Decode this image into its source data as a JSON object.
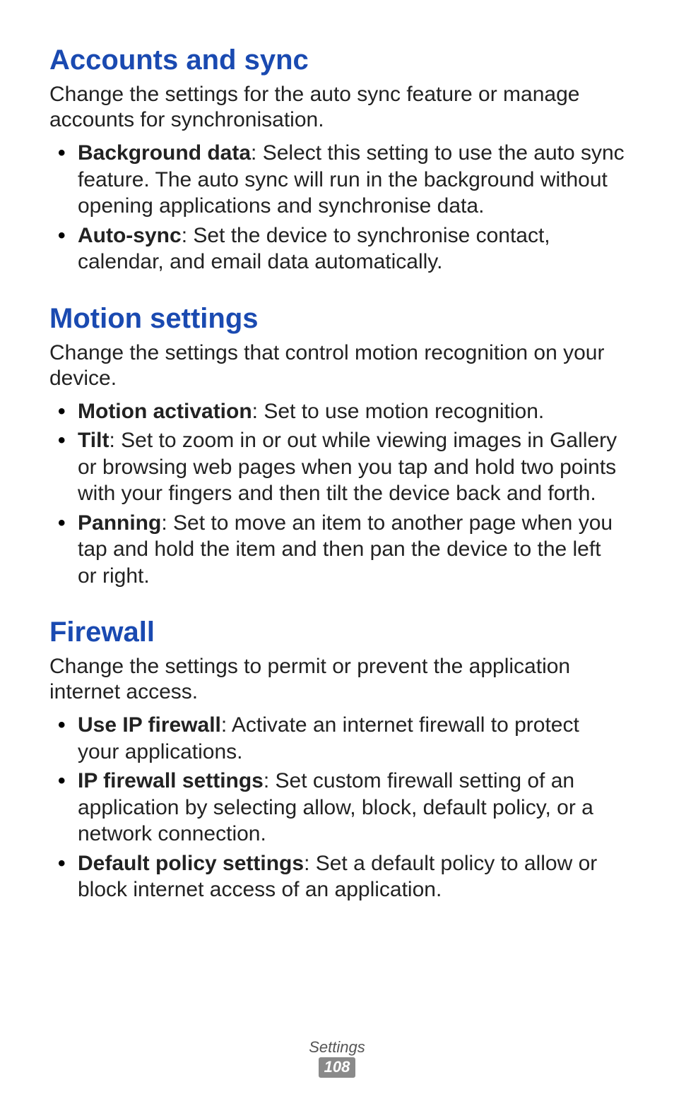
{
  "sections": [
    {
      "title": "Accounts and sync",
      "intro": "Change the settings for the auto sync feature or manage accounts for synchronisation.",
      "items": [
        {
          "term": "Background data",
          "desc": ": Select this setting to use the auto sync feature. The auto sync will run in the background without opening applications and synchronise data."
        },
        {
          "term": "Auto-sync",
          "desc": ": Set the device to synchronise contact, calendar, and email data automatically."
        }
      ]
    },
    {
      "title": "Motion settings",
      "intro": "Change the settings that control motion recognition on your device.",
      "items": [
        {
          "term": "Motion activation",
          "desc": ": Set to use motion recognition."
        },
        {
          "term": "Tilt",
          "desc": ": Set to zoom in or out while viewing images in Gallery or browsing web pages when you tap and hold two points with your fingers and then tilt the device back and forth."
        },
        {
          "term": "Panning",
          "desc": ": Set to move an item to another page when you tap and hold the item and then pan the device to the left or right."
        }
      ]
    },
    {
      "title": "Firewall",
      "intro": "Change the settings to permit or prevent the application internet access.",
      "items": [
        {
          "term": "Use IP firewall",
          "desc": ": Activate an internet firewall to protect your applications."
        },
        {
          "term": "IP firewall settings",
          "desc": ": Set custom firewall setting of an application by selecting allow, block, default policy, or a network connection."
        },
        {
          "term": "Default policy settings",
          "desc": ": Set a default policy to allow or block internet access of an application."
        }
      ]
    }
  ],
  "footer": {
    "section_label": "Settings",
    "page_number": "108"
  }
}
